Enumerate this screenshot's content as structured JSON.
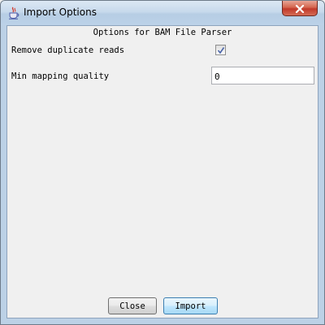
{
  "window": {
    "title": "Import Options",
    "app_icon": "java-cup-icon",
    "close_icon": "close-x-icon"
  },
  "dialog": {
    "header": "Options for BAM File Parser",
    "options": {
      "remove_duplicates": {
        "label": "Remove duplicate reads",
        "checked": true
      },
      "min_mapping_quality": {
        "label": "Min mapping quality",
        "value": "0"
      }
    }
  },
  "buttons": {
    "close_label": "Close",
    "import_label": "Import"
  },
  "colors": {
    "close_button_red": "#c1392a",
    "focused_button_blue": "#3c7fb1",
    "content_background": "#f0f0f0"
  }
}
